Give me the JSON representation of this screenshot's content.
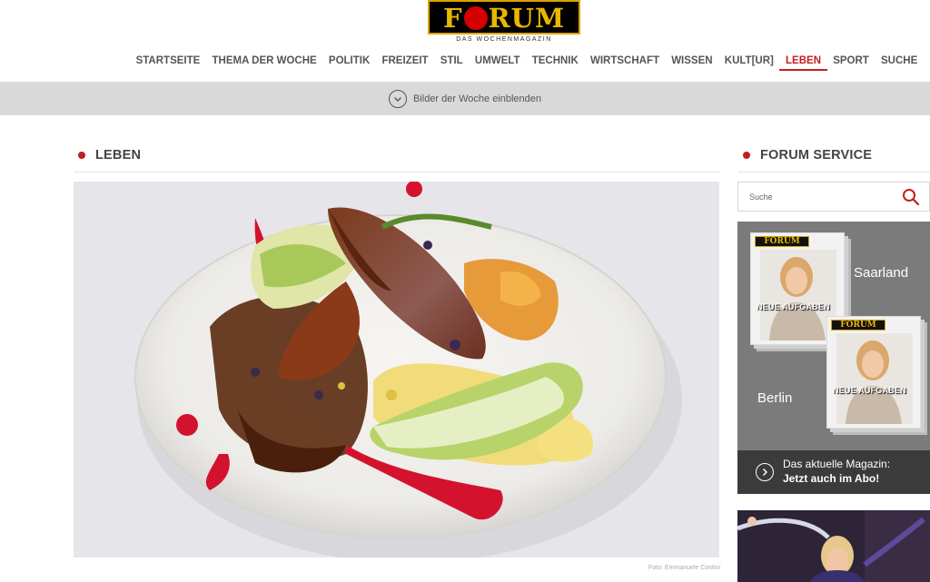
{
  "logo": {
    "text_before": "F",
    "text_after": "RUM",
    "subtitle": "DAS WOCHENMAGAZIN"
  },
  "nav": {
    "items": [
      {
        "label": "STARTSEITE"
      },
      {
        "label": "THEMA DER WOCHE"
      },
      {
        "label": "POLITIK"
      },
      {
        "label": "FREIZEIT"
      },
      {
        "label": "STIL"
      },
      {
        "label": "UMWELT"
      },
      {
        "label": "TECHNIK"
      },
      {
        "label": "WIRTSCHAFT"
      },
      {
        "label": "WISSEN"
      },
      {
        "label": "KULT[UR]"
      },
      {
        "label": "LEBEN"
      },
      {
        "label": "SPORT"
      },
      {
        "label": "SUCHE"
      }
    ],
    "active": "LEBEN"
  },
  "gallery_bar": {
    "label": "Bilder der Woche einblenden",
    "icon": "chevron-down-icon"
  },
  "main": {
    "section_title": "LEBEN",
    "photo_credit": "Foto: Emmanuele Contini"
  },
  "sidebar": {
    "section_title": "FORUM SERVICE",
    "search": {
      "placeholder": "Suche",
      "icon": "search-icon"
    },
    "promo": {
      "region_1": "Saarland",
      "region_2": "Berlin",
      "magazine_masthead": "FORUM",
      "magazine_headline": "NEUE AUFGABEN",
      "line_1": "Das aktuelle Magazin:",
      "line_2": "Jetzt auch im Abo!"
    }
  },
  "colors": {
    "accent": "#c41e1e",
    "logo_gold": "#e8b800",
    "bar_grey": "#d9d9d9",
    "promo_grey": "#7b7b7b",
    "promo_dark": "#3b3b3b"
  }
}
